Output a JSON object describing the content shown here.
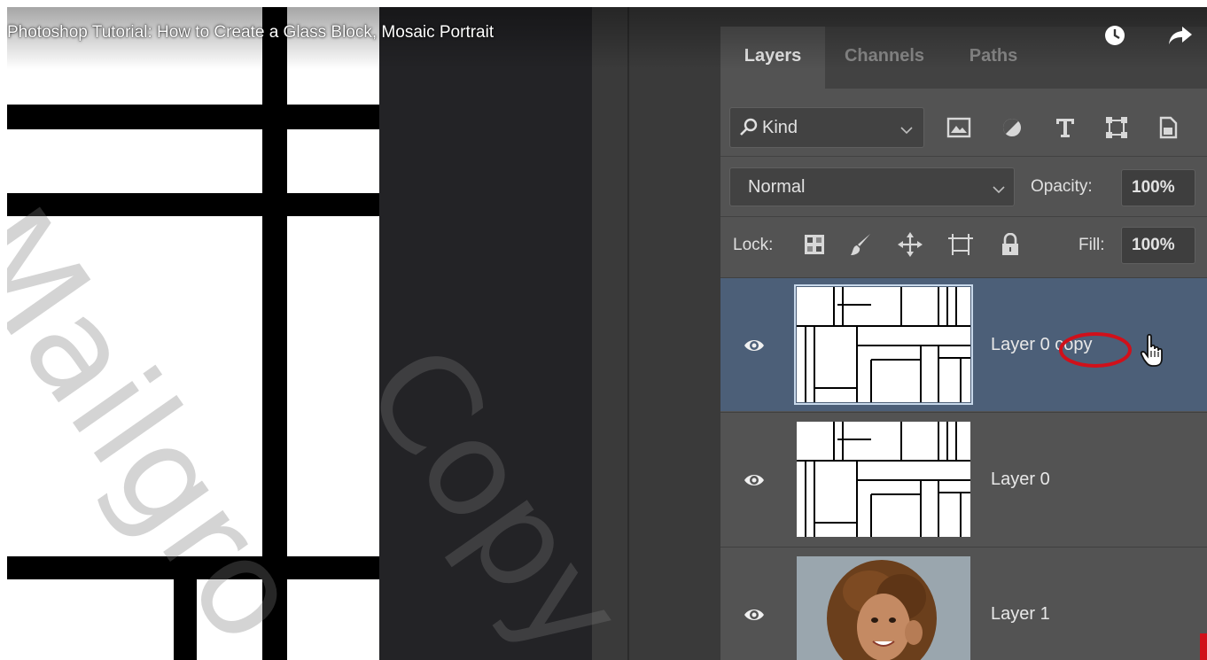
{
  "video": {
    "title": "Photoshop Tutorial: How to Create a Glass Block, Mosaic Portrait"
  },
  "player_icons": [
    "clock-icon",
    "share-arrow-icon"
  ],
  "panel": {
    "tabs": [
      {
        "label": "Layers",
        "active": true
      },
      {
        "label": "Channels",
        "active": false
      },
      {
        "label": "Paths",
        "active": false
      }
    ],
    "filter": {
      "label": "Kind",
      "icon": "search-icon"
    },
    "filter_icons": [
      "image-filter-icon",
      "adjustment-filter-icon",
      "type-filter-icon",
      "shape-filter-icon",
      "smart-object-filter-icon"
    ],
    "blend_mode": "Normal",
    "opacity_label": "Opacity:",
    "opacity_value": "100%",
    "lock_label": "Lock:",
    "lock_icons": [
      "lock-transparency-icon",
      "lock-brush-icon",
      "lock-move-icon",
      "lock-artboard-icon",
      "lock-all-icon"
    ],
    "fill_label": "Fill:",
    "fill_value": "100%"
  },
  "layers": [
    {
      "name_prefix": "Layer 0",
      "name_highlight": "copy",
      "selected": true,
      "visible": true
    },
    {
      "name": "Layer 0",
      "selected": false,
      "visible": true
    },
    {
      "name": "Layer 1",
      "selected": false,
      "visible": true
    }
  ],
  "colors": {
    "panel_bg": "#535353",
    "selected_row": "#4c5f78",
    "annotation_circle": "#d0101a"
  },
  "watermark": {
    "texts": [
      "Mailgro",
      "Copy"
    ]
  }
}
